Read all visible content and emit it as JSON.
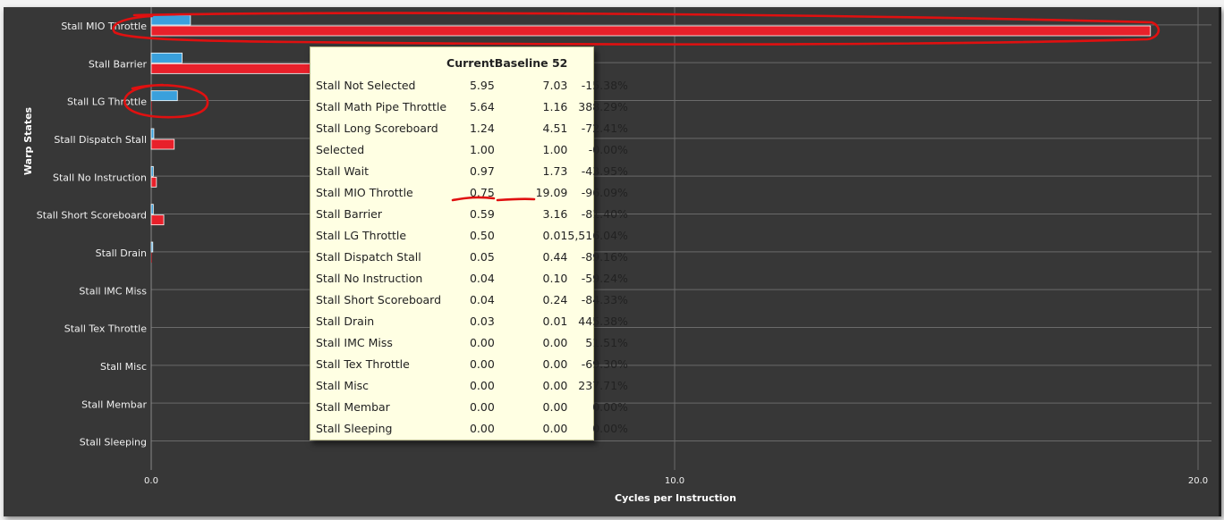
{
  "chart_data": {
    "type": "bar",
    "orientation": "horizontal",
    "categories": [
      "Stall MIO Throttle",
      "Stall Barrier",
      "Stall LG Throttle",
      "Stall Dispatch Stall",
      "Stall No Instruction",
      "Stall Short Scoreboard",
      "Stall Drain",
      "Stall IMC Miss",
      "Stall Tex Throttle",
      "Stall Misc",
      "Stall Membar",
      "Stall Sleeping"
    ],
    "series": [
      {
        "name": "Current",
        "color": "#3aa0dc",
        "values": [
          0.75,
          0.59,
          0.5,
          0.05,
          0.04,
          0.04,
          0.03,
          0.0,
          0.0,
          0.0,
          0.0,
          0.0
        ]
      },
      {
        "name": "Baseline 52",
        "color": "#e8202a",
        "values": [
          19.09,
          3.16,
          0.01,
          0.44,
          0.1,
          0.24,
          0.01,
          0.0,
          0.0,
          0.0,
          0.0,
          0.0
        ]
      }
    ],
    "xlabel": "Cycles per Instruction",
    "ylabel": "Warp States",
    "xlim": [
      0,
      20
    ],
    "xticks": [
      "0.0",
      "10.0",
      "20.0"
    ],
    "grid": true
  },
  "tooltip": {
    "headers": {
      "name": "",
      "current": "Current",
      "baseline": "Baseline 52",
      "diff": ""
    },
    "rows": [
      {
        "name": "Stall Not Selected",
        "current": "5.95",
        "baseline": "7.03",
        "diff": "-15.38%"
      },
      {
        "name": "Stall Math Pipe Throttle",
        "current": "5.64",
        "baseline": "1.16",
        "diff": "388.29%"
      },
      {
        "name": "Stall Long Scoreboard",
        "current": "1.24",
        "baseline": "4.51",
        "diff": "-72.41%"
      },
      {
        "name": "Selected",
        "current": "1.00",
        "baseline": "1.00",
        "diff": "-0.00%"
      },
      {
        "name": "Stall Wait",
        "current": "0.97",
        "baseline": "1.73",
        "diff": "-43.95%"
      },
      {
        "name": "Stall MIO Throttle",
        "current": "0.75",
        "baseline": "19.09",
        "diff": "-96.09%"
      },
      {
        "name": "Stall Barrier",
        "current": "0.59",
        "baseline": "3.16",
        "diff": "-81.40%"
      },
      {
        "name": "Stall LG Throttle",
        "current": "0.50",
        "baseline": "0.01",
        "diff": "5,516.04%"
      },
      {
        "name": "Stall Dispatch Stall",
        "current": "0.05",
        "baseline": "0.44",
        "diff": "-89.16%"
      },
      {
        "name": "Stall No Instruction",
        "current": "0.04",
        "baseline": "0.10",
        "diff": "-59.24%"
      },
      {
        "name": "Stall Short Scoreboard",
        "current": "0.04",
        "baseline": "0.24",
        "diff": "-84.33%"
      },
      {
        "name": "Stall Drain",
        "current": "0.03",
        "baseline": "0.01",
        "diff": "445.38%"
      },
      {
        "name": "Stall IMC Miss",
        "current": "0.00",
        "baseline": "0.00",
        "diff": "51.51%"
      },
      {
        "name": "Stall Tex Throttle",
        "current": "0.00",
        "baseline": "0.00",
        "diff": "-69.30%"
      },
      {
        "name": "Stall Misc",
        "current": "0.00",
        "baseline": "0.00",
        "diff": "237.71%"
      },
      {
        "name": "Stall Membar",
        "current": "0.00",
        "baseline": "0.00",
        "diff": "0.00%"
      },
      {
        "name": "Stall Sleeping",
        "current": "0.00",
        "baseline": "0.00",
        "diff": "0.00%"
      }
    ]
  },
  "annotations": {
    "color": "#e01010",
    "marks": [
      "circle-mio-throttle-bar",
      "circle-lg-throttle-label",
      "underline-mio-current",
      "underline-mio-baseline"
    ]
  }
}
